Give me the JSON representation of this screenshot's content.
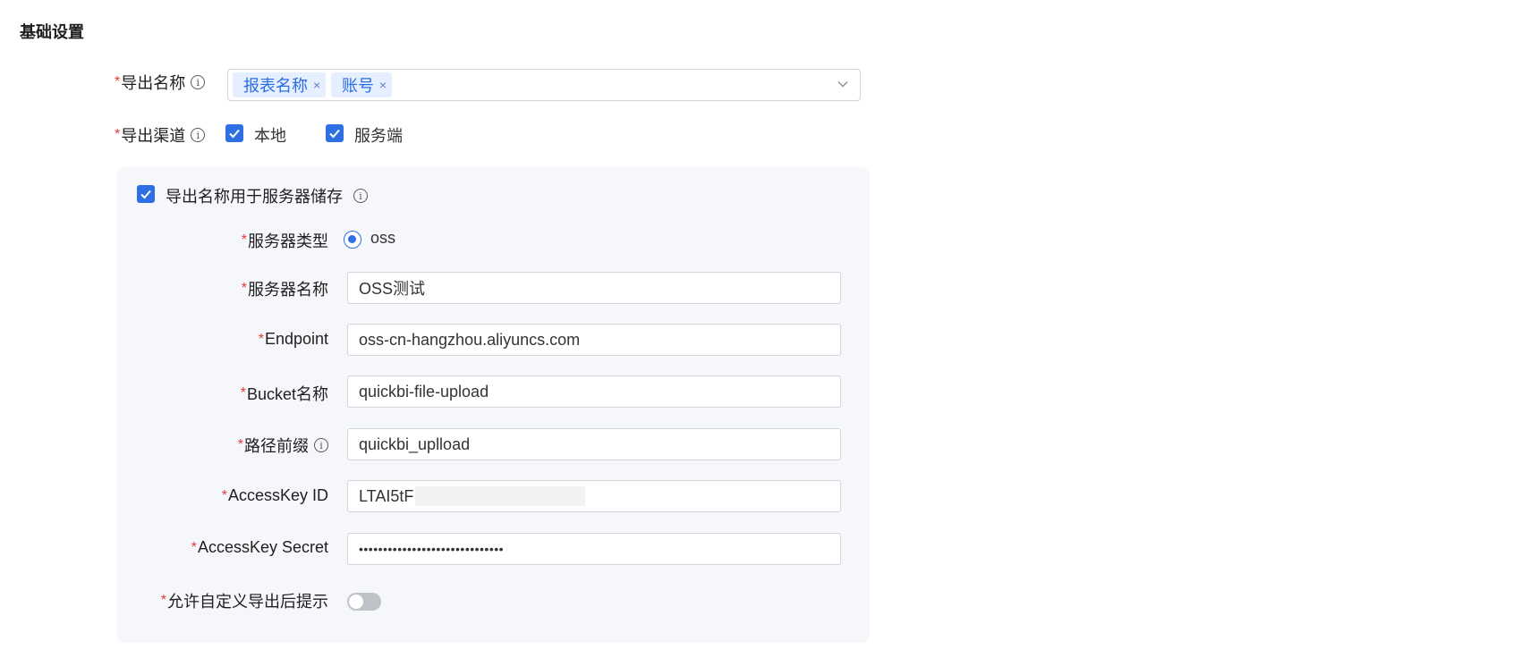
{
  "section": {
    "title": "基础设置"
  },
  "export_name": {
    "label": "导出名称",
    "required_mark": "*",
    "info_icon": "info-icon",
    "tags": [
      {
        "label": "报表名称"
      },
      {
        "label": "账号"
      }
    ],
    "remove_glyph": "×",
    "dropdown_icon": "chevron-down-icon"
  },
  "export_channel": {
    "label": "导出渠道",
    "required_mark": "*",
    "options": [
      {
        "label": "本地",
        "checked": true
      },
      {
        "label": "服务端",
        "checked": true
      }
    ]
  },
  "server_panel": {
    "use_name_checkbox": {
      "label": "导出名称用于服务器储存",
      "checked": true
    },
    "server_type": {
      "label": "服务器类型",
      "option": "oss",
      "selected": true
    },
    "server_name": {
      "label": "服务器名称",
      "value": "OSS测试"
    },
    "endpoint": {
      "label": "Endpoint",
      "value": "oss-cn-hangzhou.aliyuncs.com"
    },
    "bucket": {
      "label": "Bucket名称",
      "value": "quickbi-file-upload"
    },
    "path_prefix": {
      "label": "路径前缀",
      "value": "quickbi_uplload"
    },
    "access_key_id": {
      "label": "AccessKey ID",
      "value": "LTAI5tF"
    },
    "access_key_secret": {
      "label": "AccessKey Secret",
      "value": "••••••••••••••••••••••••••••••"
    },
    "custom_prompt": {
      "label": "允许自定义导出后提示",
      "enabled": false
    }
  },
  "colors": {
    "accent": "#2f6fe4",
    "required": "#e53935",
    "panel_bg": "#f5f7fa",
    "tag_bg": "#e6efff"
  }
}
